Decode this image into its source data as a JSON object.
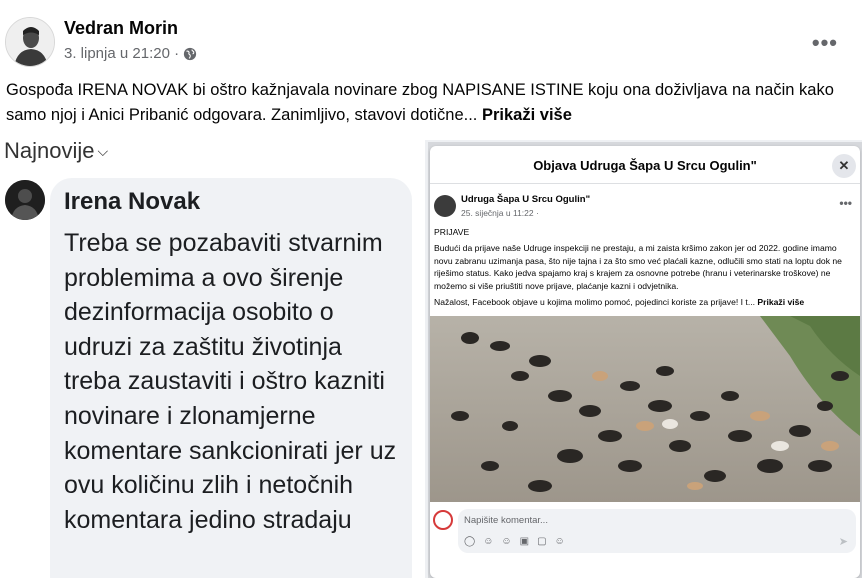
{
  "post": {
    "author": "Vedran Morin",
    "date": "3. lipnja u 21:20 ·",
    "text": "Gospođa IRENA NOVAK bi oštro kažnjavala novinare zbog NAPISANE ISTINE koju ona doživljava na način kako samo njoj i Anici Pribanić odgovara. Zanimljivo, stavovi dotične... ",
    "see_more": "Prikaži više"
  },
  "icons": {
    "globe": "globe-icon",
    "more": "more-options-icon",
    "chevron": "chevron-down-icon",
    "close": "close-icon",
    "send": "send-icon"
  },
  "left_screenshot": {
    "sort_label": "Najnovije",
    "commenter": "Irena Novak",
    "comment": "Treba se pozabaviti stvarnim problemima a ovo širenje dezinformacija osobito o udruzi za zaštitu životinja treba zaustaviti i oštro kazniti novinare i zlonamjerne komentare sankcionirati jer uz ovu količinu zlih i netočnih komentara jedino stradaju"
  },
  "right_screenshot": {
    "modal_title": "Objava Udruga Šapa U Srcu Ogulin\"",
    "page_name": "Udruga Šapa U Srcu Ogulin\"",
    "page_date": "25. siječnja u 11:22 ·",
    "label": "PRIJAVE",
    "paragraph1": "Budući da prijave naše Udruge inspekciji ne prestaju, a mi zaista kršimo zakon jer od 2022. godine imamo novu zabranu uzimanja pasa, što nije tajna i za što smo već plaćali kazne, odlučili smo stati na loptu dok ne riješimo status. Kako jedva spajamo kraj s krajem za osnovne potrebe (hranu i veterinarske troškove) ne možemo si više priuštiti nove prijave, plaćanje kazni i odvjetnika.",
    "paragraph2": "Nažalost, Facebook objave u kojima molimo pomoć, pojedinci koriste za prijave! I t... ",
    "see_more": "Prikaži više",
    "comment_placeholder": "Napišite komentar..."
  },
  "colors": {
    "text": "#050505",
    "secondary": "#65676b",
    "bubble": "#f0f2f5"
  }
}
